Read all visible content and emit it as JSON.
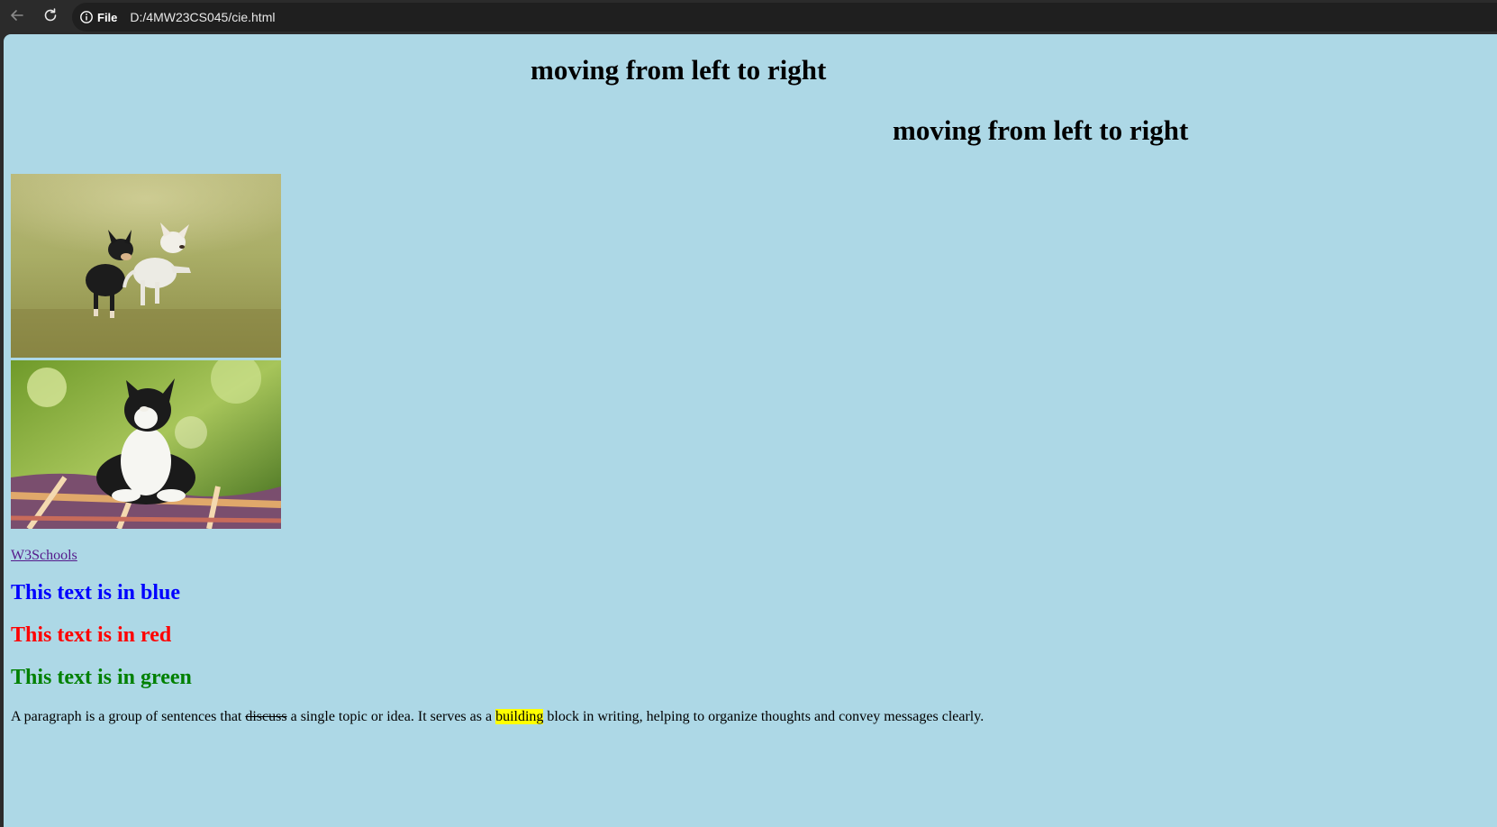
{
  "browser": {
    "site_chip_label": "File",
    "url": "D:/4MW23CS045/cie.html",
    "back_icon": "back-arrow-icon",
    "reload_icon": "reload-icon",
    "info_icon": "info-icon"
  },
  "page": {
    "background": "#add8e6",
    "marquee_1": "moving from left to right",
    "marquee_2": "moving from left to right",
    "images": [
      {
        "subject": "Two chihuahuas running on grass"
      },
      {
        "subject": "Black and white cat lying on a plaid blanket"
      }
    ],
    "link_text": "W3Schools",
    "link_color": "#551a8b",
    "blue_heading": "This text is in blue",
    "blue_color": "#0000ff",
    "red_heading": "This text is in red",
    "red_color": "#ff0000",
    "green_heading": "This text is in green",
    "green_color": "#008000",
    "paragraph": {
      "part1": "A paragraph is a group of sentences that ",
      "strike": "discuss",
      "part2": " a single topic or idea. It serves as a ",
      "highlight": "building",
      "part3": " block in writing, helping to organize thoughts and convey messages clearly.",
      "highlight_color": "#ffff00"
    }
  }
}
